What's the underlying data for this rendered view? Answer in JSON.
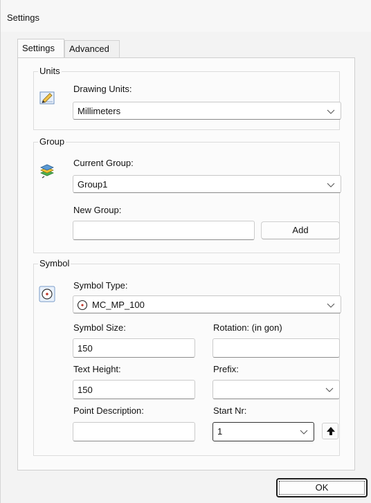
{
  "window": {
    "title": "Settings"
  },
  "tabs": [
    {
      "label": "Settings",
      "active": true
    },
    {
      "label": "Advanced",
      "active": false
    }
  ],
  "units": {
    "legend": "Units",
    "drawing_units_label": "Drawing Units:",
    "drawing_units_value": "Millimeters",
    "icon": "pencil-paper-icon"
  },
  "group": {
    "legend": "Group",
    "current_group_label": "Current Group:",
    "current_group_value": "Group1",
    "new_group_label": "New Group:",
    "new_group_value": "",
    "add_label": "Add",
    "icon": "layers-icon"
  },
  "symbol": {
    "legend": "Symbol",
    "symbol_type_label": "Symbol Type:",
    "symbol_type_value": "MC_MP_100",
    "symbol_size_label": "Symbol Size:",
    "symbol_size_value": "150",
    "rotation_label": "Rotation: (in gon)",
    "rotation_value": "",
    "text_height_label": "Text Height:",
    "text_height_value": "150",
    "prefix_label": "Prefix:",
    "prefix_value": "",
    "point_description_label": "Point Description:",
    "point_description_value": "",
    "start_nr_label": "Start Nr:",
    "start_nr_value": "1",
    "icon": "target-circle-icon"
  },
  "footer": {
    "ok_label": "OK"
  }
}
